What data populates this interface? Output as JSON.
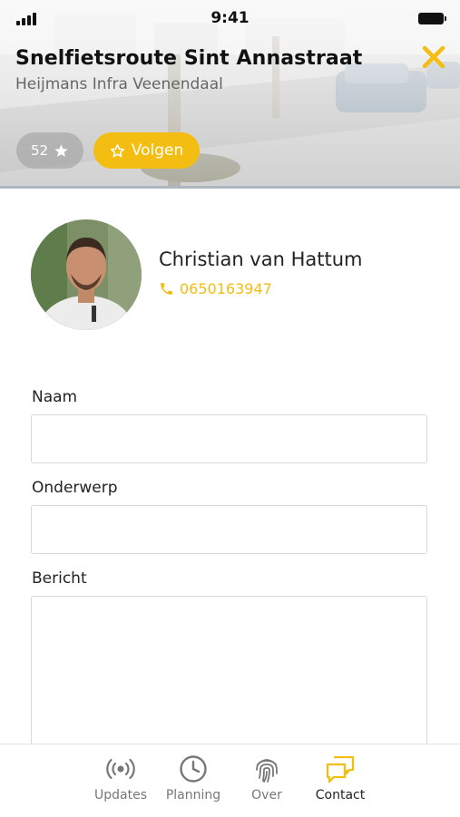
{
  "status": {
    "time": "9:41"
  },
  "header": {
    "title": "Snelfietsroute Sint Annastraat",
    "subtitle": "Heijmans Infra Veenendaal",
    "rating_count": "52",
    "follow_label": "Volgen"
  },
  "contact": {
    "name": "Christian van Hattum",
    "phone": "0650163947"
  },
  "form": {
    "name_label": "Naam",
    "subject_label": "Onderwerp",
    "message_label": "Bericht"
  },
  "tabs": [
    {
      "label": "Updates",
      "icon": "broadcast-icon"
    },
    {
      "label": "Planning",
      "icon": "clock-icon"
    },
    {
      "label": "Over",
      "icon": "fingerprint-icon"
    },
    {
      "label": "Contact",
      "icon": "chat-icon"
    }
  ],
  "colors": {
    "accent": "#f4bd12",
    "text": "#222222",
    "muted": "#777777"
  }
}
